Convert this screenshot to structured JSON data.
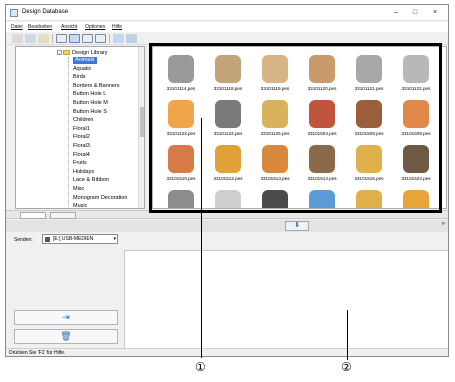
{
  "window": {
    "title": "Design Database",
    "minimize_glyph": "–",
    "maximize_glyph": "□",
    "close_glyph": "×"
  },
  "menu": [
    "Datei",
    "Bearbeiten",
    "Ansicht",
    "Optionen",
    "Hilfe"
  ],
  "tree": {
    "root_label": "Design Library",
    "expander_glyph": "-",
    "items": [
      {
        "label": "Animals",
        "selected": true
      },
      {
        "label": "Aquatic"
      },
      {
        "label": "Birds"
      },
      {
        "label": "Borders & Banners"
      },
      {
        "label": "Button Hole L"
      },
      {
        "label": "Button Hole M"
      },
      {
        "label": "Button Hole S"
      },
      {
        "label": "Children"
      },
      {
        "label": "Floral1"
      },
      {
        "label": "Floral2"
      },
      {
        "label": "Floral3"
      },
      {
        "label": "Floral4"
      },
      {
        "label": "Fruits"
      },
      {
        "label": "Holidays"
      },
      {
        "label": "Lace & Ribbon"
      },
      {
        "label": "Misc"
      },
      {
        "label": "Monogram Decoration"
      },
      {
        "label": "Music"
      }
    ]
  },
  "thumbnails": [
    {
      "name": "33101114.pes",
      "icon": "cat-icon",
      "color": "#9a9a9a"
    },
    {
      "name": "33101118.pes",
      "icon": "dog-icon",
      "color": "#c4a47a"
    },
    {
      "name": "33101119.pes",
      "icon": "dog-icon",
      "color": "#d6b484"
    },
    {
      "name": "33101120.pes",
      "icon": "dog-icon",
      "color": "#c89c6a"
    },
    {
      "name": "33101121.pes",
      "icon": "cat-icon",
      "color": "#a8a8a8"
    },
    {
      "name": "33101122.pes",
      "icon": "cat-icon",
      "color": "#b8b8b8"
    },
    {
      "name": "33101123.pes",
      "icon": "cat-icon",
      "color": "#f0a54a"
    },
    {
      "name": "33101124.pes",
      "icon": "cat-icon",
      "color": "#7a7a7a"
    },
    {
      "name": "33101125.pes",
      "icon": "cat-icon",
      "color": "#d9b25e"
    },
    {
      "name": "33101504.pes",
      "icon": "bear-icon",
      "color": "#c0543c"
    },
    {
      "name": "33101508.pes",
      "icon": "bear-icon",
      "color": "#9b5e3a"
    },
    {
      "name": "33101509.pes",
      "icon": "bear-icon",
      "color": "#e0874a"
    },
    {
      "name": "33101510.pes",
      "icon": "bear-icon",
      "color": "#d77a4a"
    },
    {
      "name": "33101512.pes",
      "icon": "bear-icon",
      "color": "#e2a23b"
    },
    {
      "name": "33101513.pes",
      "icon": "bear-icon",
      "color": "#d88a3c"
    },
    {
      "name": "33101514.pes",
      "icon": "bear-icon",
      "color": "#8a6a48"
    },
    {
      "name": "33101515.pes",
      "icon": "bear-icon",
      "color": "#e0b04c"
    },
    {
      "name": "33101522.pes",
      "icon": "beetle-icon",
      "color": "#6e5a44"
    },
    {
      "name": "",
      "icon": "animal-icon",
      "color": "#8c8c8c"
    },
    {
      "name": "",
      "icon": "animal-icon",
      "color": "#cfcfcf"
    },
    {
      "name": "",
      "icon": "animal-icon",
      "color": "#4b4b4b"
    },
    {
      "name": "",
      "icon": "elephant-icon",
      "color": "#5b9bd6"
    },
    {
      "name": "",
      "icon": "giraffe-icon",
      "color": "#e2b04a"
    },
    {
      "name": "",
      "icon": "lion-icon",
      "color": "#e7a43a"
    }
  ],
  "lower": {
    "send_label": "Senden:",
    "send_value": "[E:] USB-MEDIEN",
    "send_caret": "▾",
    "transfer_glyph": "⬇",
    "collapse_glyph": "»",
    "send_button_glyph": "⇥",
    "delete_button_glyph": "🗑"
  },
  "status": {
    "text": "Drücken Sie 'F1' für Hilfe."
  },
  "callouts": {
    "one": "①",
    "two": "②"
  }
}
